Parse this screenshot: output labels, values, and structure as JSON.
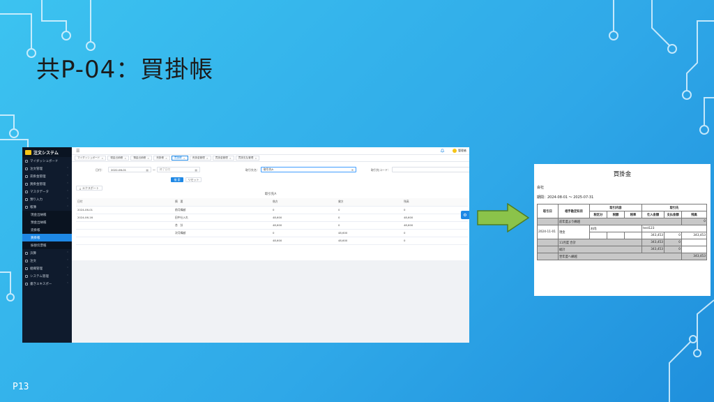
{
  "slide": {
    "title": "共P-04：買掛帳",
    "page_number": "P13"
  },
  "app": {
    "logo_text": "注文システム",
    "sidebar": {
      "items": [
        {
          "label": "マイダッシュボード",
          "chev": ""
        },
        {
          "label": "注文管理",
          "chev": "˅"
        },
        {
          "label": "売掛金管理",
          "chev": "˅"
        },
        {
          "label": "買掛金管理",
          "chev": "˅"
        },
        {
          "label": "マスタデータ",
          "chev": "˅"
        },
        {
          "label": "預り入力",
          "chev": "˅"
        },
        {
          "label": "帳簿",
          "chev": "˄"
        }
      ],
      "subitems": [
        "現金出納帳",
        "預金出納帳",
        "売掛帳",
        "買掛帳",
        "振替伝票帳"
      ],
      "active_subitem": "買掛帳",
      "items_after": [
        {
          "label": "決算",
          "chev": "˅"
        },
        {
          "label": "注文",
          "chev": "˅"
        },
        {
          "label": "組織管理",
          "chev": "˅"
        },
        {
          "label": "システム管理",
          "chev": "˅"
        },
        {
          "label": "書きエキスポー",
          "chev": "˅"
        }
      ]
    },
    "topbar": {
      "menu_icon": "☰",
      "bell_icon": "🔔",
      "user_name": "管理者"
    },
    "tabs": [
      {
        "label": "マイダッシュボード"
      },
      {
        "label": "現金出納帳"
      },
      {
        "label": "預金出納帳"
      },
      {
        "label": "売掛帳"
      },
      {
        "label": "買掛帳"
      },
      {
        "label": "売掛金管理"
      },
      {
        "label": "買掛金管理"
      },
      {
        "label": "買掛支払管理"
      }
    ],
    "active_tab": "買掛帳",
    "form": {
      "date_label": "日付：",
      "date_from": "2022-06-01",
      "date_separator": "～",
      "date_to_placeholder": "終了日付",
      "supplier_name_label": "取引先名：",
      "supplier_name_value": "取引先A",
      "supplier_code_label": "取引先コード：",
      "search_button": "検 索",
      "reset_button": "リセット",
      "export_button": "エクスポート"
    },
    "table": {
      "title": "取引先A",
      "columns": [
        "日付",
        "摘　要",
        "借方",
        "貸方",
        "残高"
      ],
      "rows": [
        [
          "2024-06-01",
          "前月繰越",
          "0",
          "0",
          "0"
        ],
        [
          "2024-06-16",
          "田中仕入れ",
          "48,600",
          "0",
          "48,600"
        ],
        [
          "",
          "合　計",
          "48,600",
          "0",
          "48,600"
        ],
        [
          "",
          "次月繰越",
          "0",
          "48,600",
          "0"
        ],
        [
          "",
          "",
          "48,600",
          "48,600",
          "0"
        ]
      ]
    },
    "fab_icon": "⚙"
  },
  "ledger": {
    "title": "買掛金",
    "company": "会社",
    "period": "期間：2024-08-01 ～ 2025-07-31",
    "headers": {
      "date": "取引日",
      "account": "相手勘定科目",
      "content": "取引内容",
      "supplier": "取引先",
      "tax_class": "税区分",
      "tax_amount": "税額",
      "tax_rate": "税率",
      "purchase_amount": "仕入金額",
      "payment_amount": "支払金額",
      "balance": "残高"
    },
    "carry_in_label": "前年度より繰越",
    "carry_in_value": "0",
    "entry": {
      "date": "2024-11-01",
      "account": "現金",
      "content": "お肉",
      "supplier": "test123",
      "purchase": "343,453",
      "payment": "0",
      "balance": "343,453"
    },
    "month_total": {
      "label": "11月度 合計",
      "purchase": "343,453",
      "payment": "0"
    },
    "total": {
      "label": "総計",
      "purchase": "343,453",
      "payment": "0"
    },
    "carry_out": {
      "label": "翌年度へ繰越",
      "balance": "343,453"
    }
  },
  "colors": {
    "accent": "#1e88e5",
    "sidebar_bg": "#0f1b2d",
    "arrow": "#8bc34a",
    "background": "#2fa8e8"
  }
}
